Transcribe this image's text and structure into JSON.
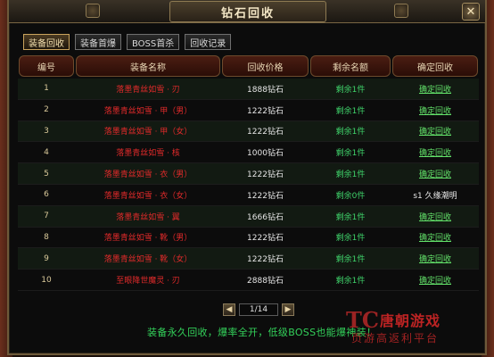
{
  "window": {
    "title": "钻石回收",
    "close_glyph": "✕"
  },
  "tabs": [
    {
      "label": "装备回收",
      "active": true
    },
    {
      "label": "装备首爆",
      "active": false
    },
    {
      "label": "BOSS首杀",
      "active": false
    },
    {
      "label": "回收记录",
      "active": false
    }
  ],
  "table": {
    "headers": [
      "编号",
      "装备名称",
      "回收价格",
      "剩余名额",
      "确定回收"
    ],
    "rows": [
      {
        "id": "1",
        "name": "落墨青丝如雪 · 刃",
        "price": "1888钻石",
        "remain": "剩余1件",
        "action": "确定回收",
        "link": true
      },
      {
        "id": "2",
        "name": "落墨青丝如雪 · 甲（男）",
        "price": "1222钻石",
        "remain": "剩余1件",
        "action": "确定回收",
        "link": true
      },
      {
        "id": "3",
        "name": "落墨青丝如雪 · 甲（女）",
        "price": "1222钻石",
        "remain": "剩余1件",
        "action": "确定回收",
        "link": true
      },
      {
        "id": "4",
        "name": "落墨青丝如雪 · 核",
        "price": "1000钻石",
        "remain": "剩余1件",
        "action": "确定回收",
        "link": true
      },
      {
        "id": "5",
        "name": "落墨青丝如雪 · 衣（男）",
        "price": "1222钻石",
        "remain": "剩余1件",
        "action": "确定回收",
        "link": true
      },
      {
        "id": "6",
        "name": "落墨青丝如雪 · 衣（女）",
        "price": "1222钻石",
        "remain": "剩余0件",
        "action": "s1 久缘潮明",
        "link": false
      },
      {
        "id": "7",
        "name": "落墨青丝如雪 · 翼",
        "price": "1666钻石",
        "remain": "剩余1件",
        "action": "确定回收",
        "link": true
      },
      {
        "id": "8",
        "name": "落墨青丝如雪 · 靴（男）",
        "price": "1222钻石",
        "remain": "剩余1件",
        "action": "确定回收",
        "link": true
      },
      {
        "id": "9",
        "name": "落墨青丝如雪 · 靴（女）",
        "price": "1222钻石",
        "remain": "剩余1件",
        "action": "确定回收",
        "link": true
      },
      {
        "id": "10",
        "name": "至眼降世魔灵 · 刃",
        "price": "2888钻石",
        "remain": "剩余1件",
        "action": "确定回收",
        "link": true
      }
    ]
  },
  "pager": {
    "prev_glyph": "◀",
    "next_glyph": "▶",
    "page_text": "1/14"
  },
  "notice": "装备永久回收，爆率全开，低级BOSS也能爆神装！",
  "watermark": {
    "logo": "TC",
    "main": "唐朝游戏",
    "sub": "页游高返利平台"
  },
  "colors": {
    "accent_gold": "#c9a35c",
    "name_red": "#e02a2a",
    "remain_green": "#3fd36a",
    "action_green": "#63e36a"
  }
}
